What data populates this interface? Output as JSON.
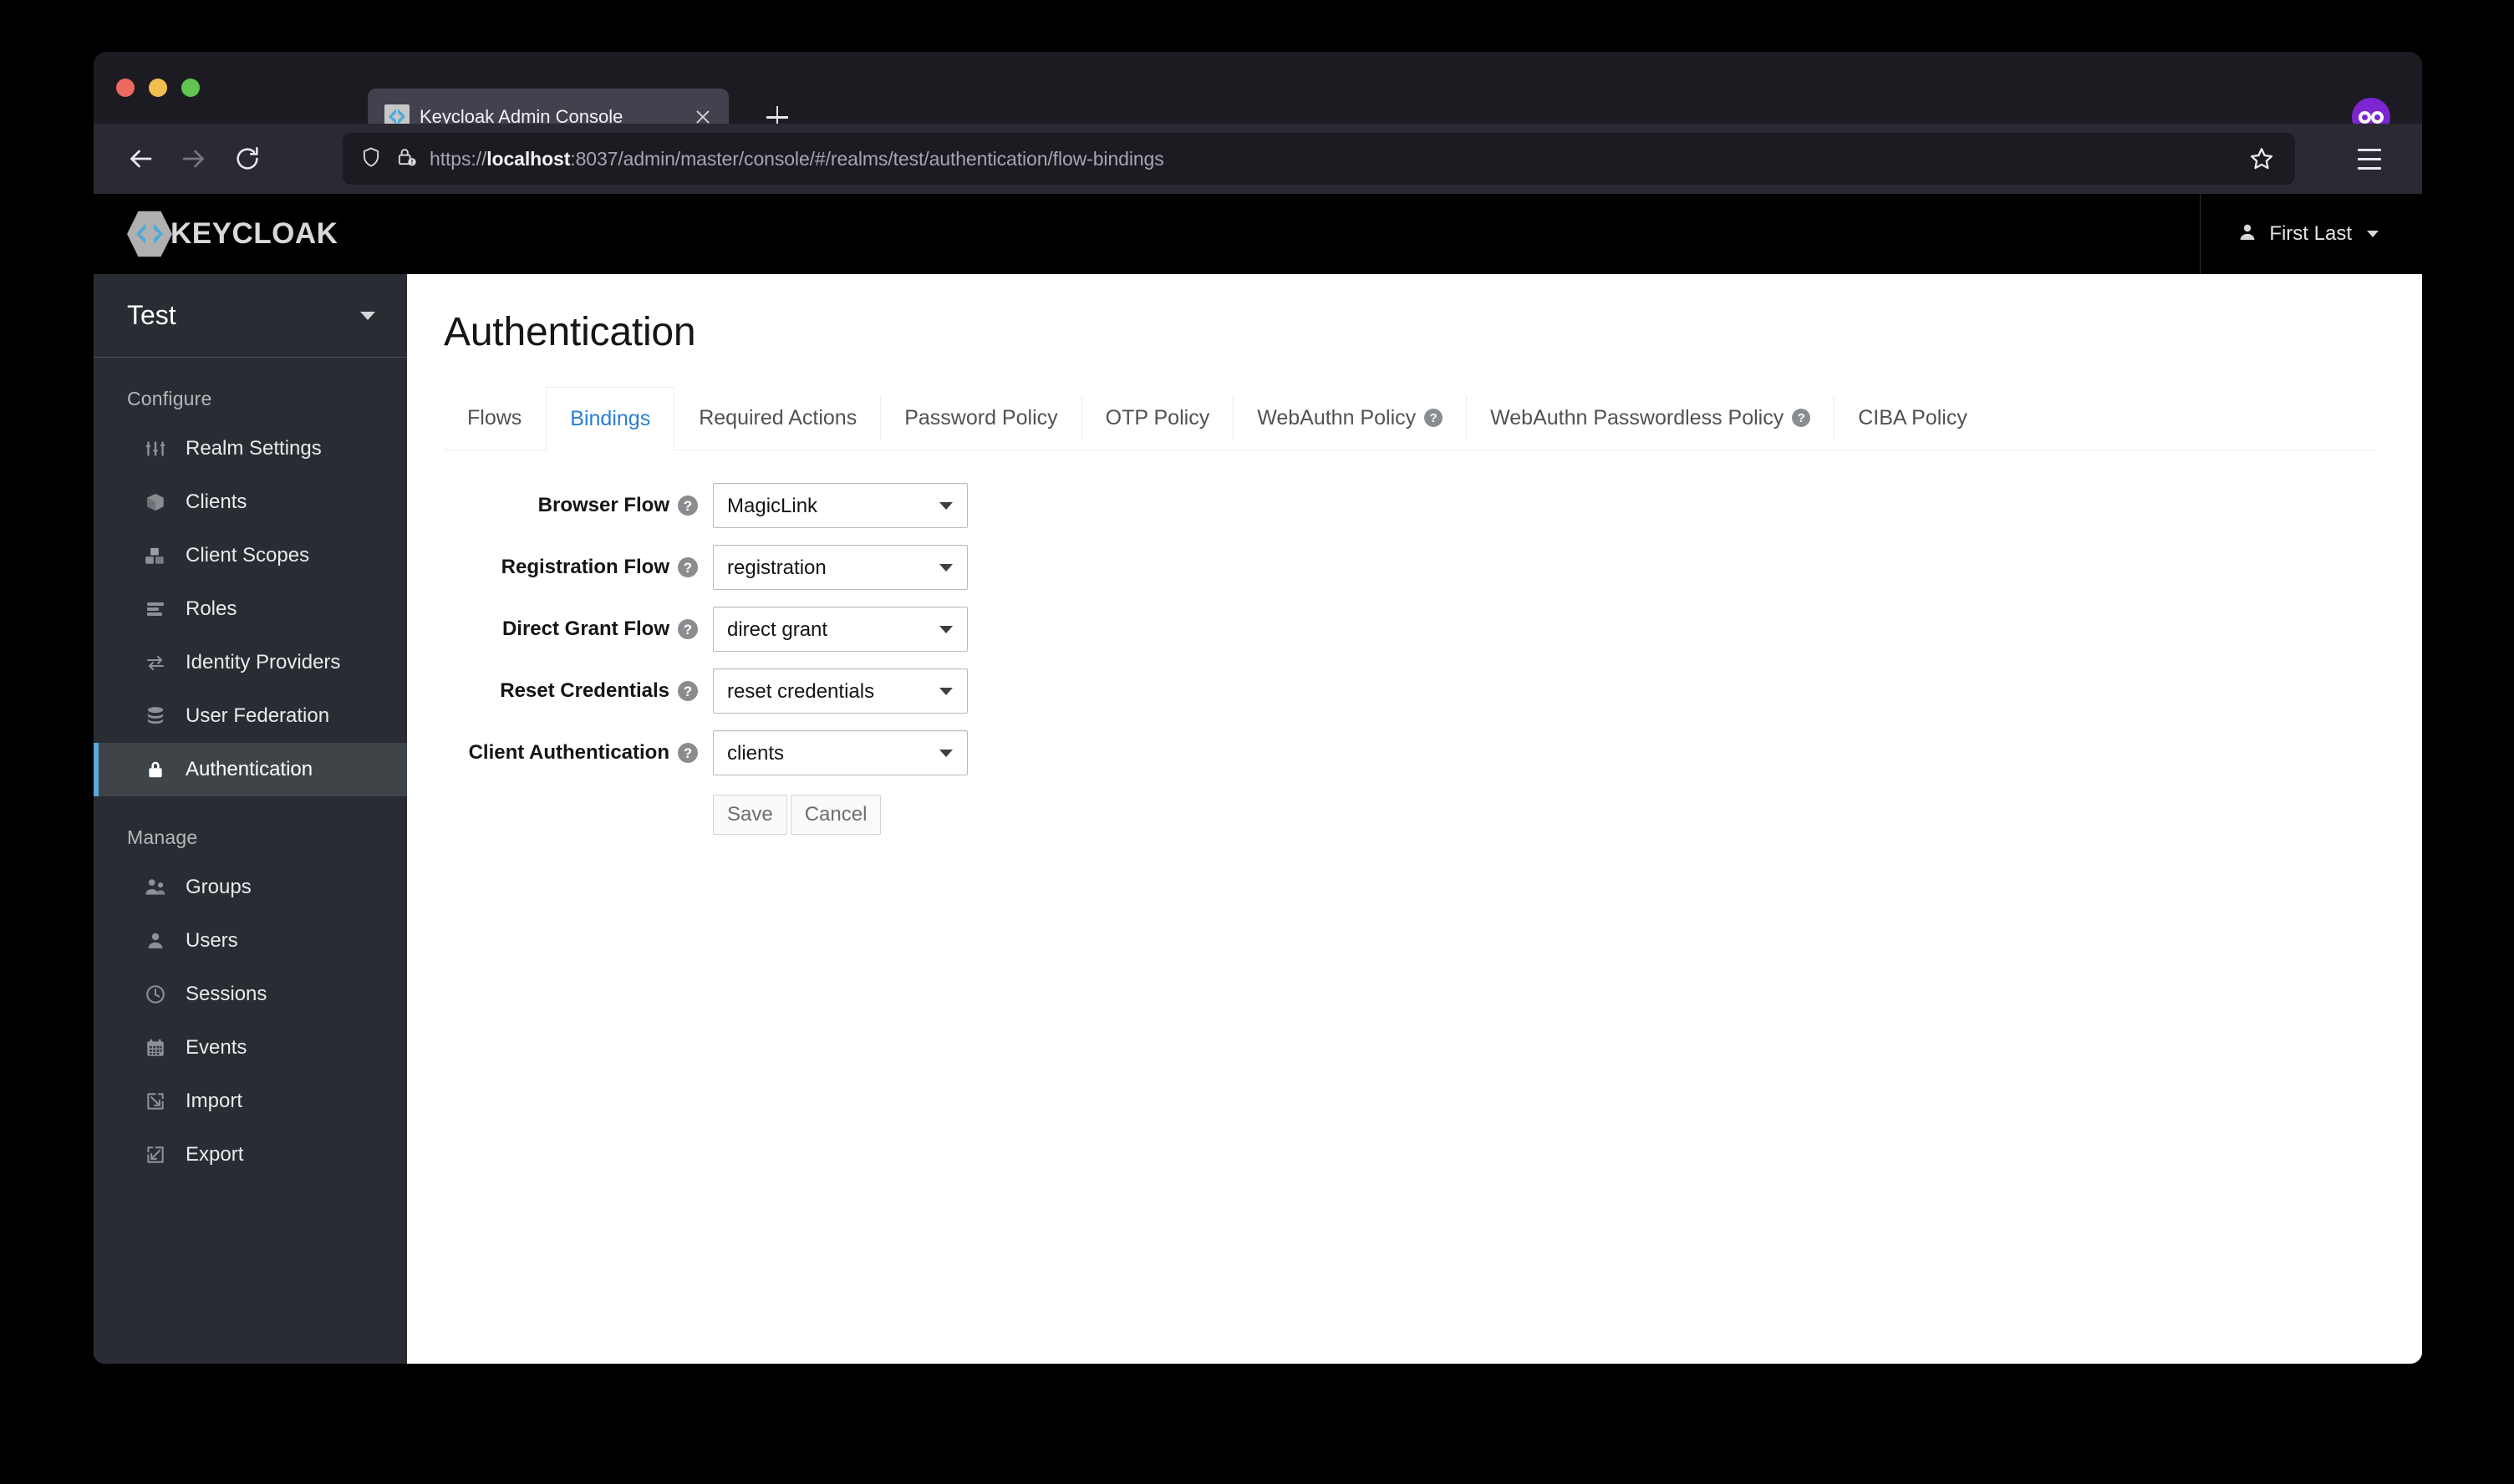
{
  "browser": {
    "tab": {
      "title": "Keycloak Admin Console",
      "favicon": "keycloak-favicon",
      "close_label": "close-tab"
    },
    "new_tab_label": "New Tab",
    "url": {
      "scheme": "https://",
      "host": "localhost",
      "rest": ":8037/admin/master/console/#/realms/test/authentication/flow-bindings",
      "full": "https://localhost:8037/admin/master/console/#/realms/test/authentication/flow-bindings"
    },
    "private_mode": true
  },
  "masthead": {
    "brand": "KEYCLOAK",
    "user": {
      "name": "First Last"
    }
  },
  "sidebar": {
    "realm": "Test",
    "sections": [
      {
        "title": "Configure",
        "items": [
          {
            "label": "Realm Settings",
            "icon": "sliders-icon",
            "active": false
          },
          {
            "label": "Clients",
            "icon": "cube-icon",
            "active": false
          },
          {
            "label": "Client Scopes",
            "icon": "blocks-icon",
            "active": false
          },
          {
            "label": "Roles",
            "icon": "list-bars-icon",
            "active": false
          },
          {
            "label": "Identity Providers",
            "icon": "exchange-arrows-icon",
            "active": false
          },
          {
            "label": "User Federation",
            "icon": "database-icon",
            "active": false
          },
          {
            "label": "Authentication",
            "icon": "lock-icon",
            "active": true
          }
        ]
      },
      {
        "title": "Manage",
        "items": [
          {
            "label": "Groups",
            "icon": "users-group-icon",
            "active": false
          },
          {
            "label": "Users",
            "icon": "user-icon",
            "active": false
          },
          {
            "label": "Sessions",
            "icon": "clock-icon",
            "active": false
          },
          {
            "label": "Events",
            "icon": "calendar-icon",
            "active": false
          },
          {
            "label": "Import",
            "icon": "import-arrow-icon",
            "active": false
          },
          {
            "label": "Export",
            "icon": "export-arrow-icon",
            "active": false
          }
        ]
      }
    ]
  },
  "main": {
    "page_title": "Authentication",
    "tabs": [
      {
        "label": "Flows",
        "active": false,
        "help": false
      },
      {
        "label": "Bindings",
        "active": true,
        "help": false
      },
      {
        "label": "Required Actions",
        "active": false,
        "help": false
      },
      {
        "label": "Password Policy",
        "active": false,
        "help": false
      },
      {
        "label": "OTP Policy",
        "active": false,
        "help": false
      },
      {
        "label": "WebAuthn Policy",
        "active": false,
        "help": true
      },
      {
        "label": "WebAuthn Passwordless Policy",
        "active": false,
        "help": true
      },
      {
        "label": "CIBA Policy",
        "active": false,
        "help": false
      }
    ],
    "help_glyph": "?",
    "form": {
      "fields": [
        {
          "label": "Browser Flow",
          "value": "MagicLink",
          "help": true
        },
        {
          "label": "Registration Flow",
          "value": "registration",
          "help": true
        },
        {
          "label": "Direct Grant Flow",
          "value": "direct grant",
          "help": true
        },
        {
          "label": "Reset Credentials",
          "value": "reset credentials",
          "help": true
        },
        {
          "label": "Client Authentication",
          "value": "clients",
          "help": true
        }
      ],
      "save_label": "Save",
      "cancel_label": "Cancel"
    }
  },
  "colors": {
    "accent_blue": "#2b7dd4",
    "sidebar_active_bar": "#58a9e0",
    "sidebar_bg": "#292d33",
    "masthead_bg": "#000000",
    "private_badge": "#7d25d1"
  }
}
